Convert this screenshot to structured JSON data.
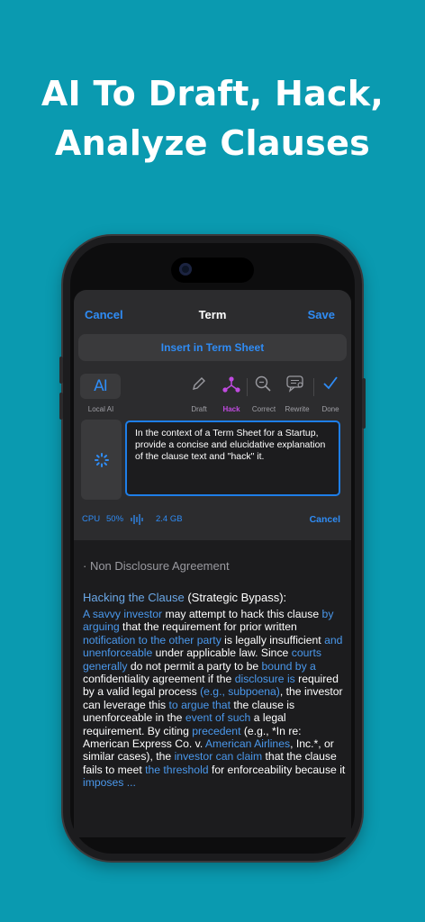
{
  "headline": {
    "line1": "AI To Draft, Hack,",
    "line2": "Analyze Clauses"
  },
  "navbar": {
    "cancel": "Cancel",
    "title": "Term",
    "save": "Save"
  },
  "insert_button": "Insert in Term Sheet",
  "toolbar": {
    "ai_badge": "AI",
    "local_ai": "Local AI",
    "tools": [
      {
        "label": "Draft",
        "icon": "pencil-icon"
      },
      {
        "label": "Hack",
        "icon": "hack-nodes-icon",
        "active": true,
        "color": "#c04ae0"
      },
      {
        "label": "Correct",
        "icon": "magnify-icon"
      },
      {
        "label": "Rewrite",
        "icon": "chat-rewrite-icon"
      },
      {
        "label": "Done",
        "icon": "checkmark-icon"
      }
    ]
  },
  "prompt_text": "In the context of a Term Sheet for a Startup, provide a concise and elucidative explanation of the clause text and \"hack\" it.",
  "status": {
    "cpu_label": "CPU",
    "cpu_value": "50%",
    "memory": "2.4 GB",
    "cancel": "Cancel"
  },
  "output": {
    "heading": "· Non Disclosure Agreement",
    "hack_title_blue": "Hacking the Clause",
    "hack_title_rest": " (Strategic Bypass):",
    "segments": [
      {
        "t": "A savvy investor",
        "blue": true
      },
      {
        "t": " may attempt to hack this clause ",
        "blue": false
      },
      {
        "t": "by arguing",
        "blue": true
      },
      {
        "t": " that the requirement for prior written ",
        "blue": false
      },
      {
        "t": "notification to the other party",
        "blue": true
      },
      {
        "t": " is legally insufficient ",
        "blue": false
      },
      {
        "t": "and unenforceable",
        "blue": true
      },
      {
        "t": " under applicable law. Since ",
        "blue": false
      },
      {
        "t": "courts generally",
        "blue": true
      },
      {
        "t": " do not permit a party to be ",
        "blue": false
      },
      {
        "t": "bound by a",
        "blue": true
      },
      {
        "t": " confidentiality agreement if the ",
        "blue": false
      },
      {
        "t": "disclosure is",
        "blue": true
      },
      {
        "t": " required by a valid legal process ",
        "blue": false
      },
      {
        "t": "(e.g., subpoena)",
        "blue": true
      },
      {
        "t": ", the investor can leverage this ",
        "blue": false
      },
      {
        "t": "to argue that",
        "blue": true
      },
      {
        "t": " the clause is unenforceable in the ",
        "blue": false
      },
      {
        "t": "event of such",
        "blue": true
      },
      {
        "t": " a legal requirement. By citing ",
        "blue": false
      },
      {
        "t": "precedent",
        "blue": true
      },
      {
        "t": " (e.g., *In re: American Express Co. v. ",
        "blue": false
      },
      {
        "t": "American Airlines",
        "blue": true
      },
      {
        "t": ", Inc.*, or similar cases), the ",
        "blue": false
      },
      {
        "t": "investor can claim",
        "blue": true
      },
      {
        "t": " that the clause fails to meet ",
        "blue": false
      },
      {
        "t": "the threshold",
        "blue": true
      },
      {
        "t": " for enforceability because it ",
        "blue": false
      },
      {
        "t": "imposes ...",
        "blue": true
      }
    ]
  },
  "colors": {
    "background": "#0a9ab0",
    "accent": "#2f8cf5",
    "hack": "#c04ae0"
  }
}
